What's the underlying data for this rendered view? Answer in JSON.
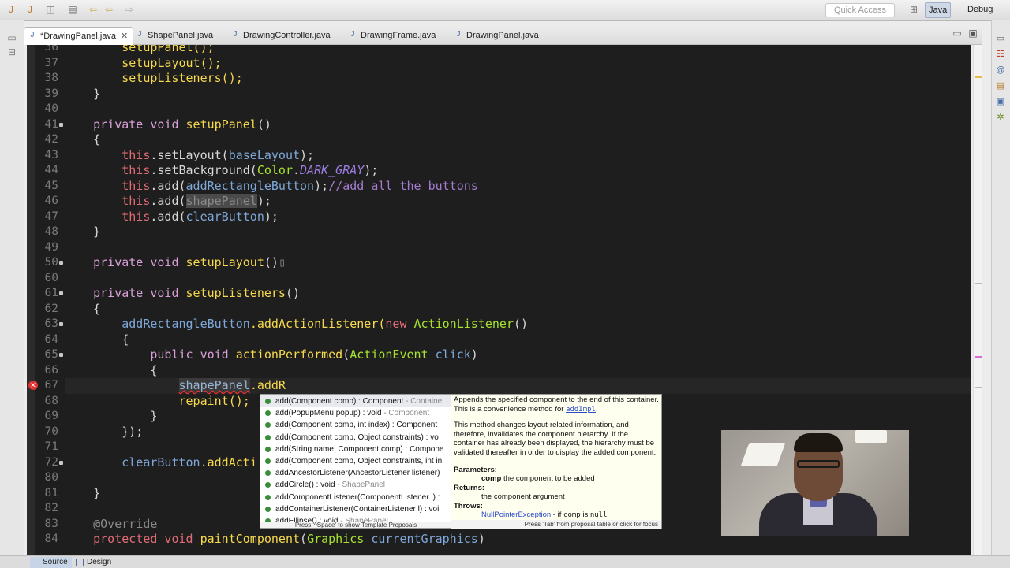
{
  "toolbar": {
    "quick_access_placeholder": "Quick Access",
    "perspectives": [
      {
        "label": "Java"
      },
      {
        "label": "Debug"
      }
    ],
    "icons": [
      "new-file-icon",
      "save-icon",
      "build-icon",
      "debug-icon",
      "run-icon",
      "back-icon",
      "forward-icon"
    ]
  },
  "tabs": [
    {
      "label": "*DrawingPanel.java",
      "close": "✕"
    },
    {
      "label": "ShapePanel.java"
    },
    {
      "label": "DrawingController.java"
    },
    {
      "label": "DrawingFrame.java"
    },
    {
      "label": "DrawingPanel.java"
    }
  ],
  "code": [
    {
      "n": "36",
      "text": "        setupPanel();"
    },
    {
      "n": "37",
      "text": "        setupLayout();"
    },
    {
      "n": "38",
      "text": "        setupListeners();"
    },
    {
      "n": "39",
      "text": "    }"
    },
    {
      "n": "40",
      "text": ""
    },
    {
      "n": "41",
      "kw": "    private void ",
      "m": "setupPanel",
      "rest": "()"
    },
    {
      "n": "42",
      "text": "    {"
    },
    {
      "n": "43",
      "this": "        this",
      "a": ".setLayout(",
      "f": "baseLayout",
      "b": ");"
    },
    {
      "n": "44",
      "this": "        this",
      "a": ".setBackground(",
      "t": "Color",
      "dot": ".",
      "c": "DARK_GRAY",
      "b": ");"
    },
    {
      "n": "45",
      "this": "        this",
      "a": ".add(",
      "f": "addRectangleButton",
      "b": ");",
      "cm": "//add all the buttons"
    },
    {
      "n": "46",
      "this": "        this",
      "a": ".add(",
      "hl": "shapePanel",
      "b": ");"
    },
    {
      "n": "47",
      "this": "        this",
      "a": ".add(",
      "f": "clearButton",
      "b": ");"
    },
    {
      "n": "48",
      "text": "    }"
    },
    {
      "n": "49",
      "text": ""
    },
    {
      "n": "50",
      "kw": "    private void ",
      "m": "setupLayout",
      "rest": "()",
      "box": "▯"
    },
    {
      "n": "60",
      "text": ""
    },
    {
      "n": "61",
      "kw": "    private void ",
      "m": "setupListeners",
      "rest": "()"
    },
    {
      "n": "62",
      "text": "    {"
    },
    {
      "n": "63",
      "f": "        addRectangleButton",
      "a": ".addActionListener(",
      "nw": "new ",
      "t": "ActionListener",
      "b": "()"
    },
    {
      "n": "64",
      "text": "        {"
    },
    {
      "n": "65",
      "kw": "            public void ",
      "m": "actionPerformed",
      "a": "(",
      "t": "ActionEvent",
      "sp": " ",
      "f": "click",
      "b": ")"
    },
    {
      "n": "66",
      "text": "            {"
    },
    {
      "n": "67",
      "err": "shapePanel",
      "a": ".addR"
    },
    {
      "n": "68",
      "text": "                repaint();"
    },
    {
      "n": "69",
      "text": "            }"
    },
    {
      "n": "70",
      "text": "        });"
    },
    {
      "n": "71",
      "text": ""
    },
    {
      "n": "72",
      "f": "        clearButton",
      "a": ".addActi"
    },
    {
      "n": "80",
      "text": ""
    },
    {
      "n": "81",
      "text": "    }"
    },
    {
      "n": "82",
      "text": ""
    },
    {
      "n": "83",
      "ann": "    @Override"
    },
    {
      "n": "84",
      "kw": "    protected void ",
      "m": "paintComponent",
      "a": "(",
      "t": "Graphics",
      "sp": " ",
      "f": "currentGraphics",
      "b": ")"
    }
  ],
  "completion": {
    "items": [
      {
        "text": "add(Component comp) : Component",
        "owner": " - Containe"
      },
      {
        "text": "add(PopupMenu popup) : void",
        "owner": " - Component"
      },
      {
        "text": "add(Component comp, int index) : Component",
        "owner": ""
      },
      {
        "text": "add(Component comp, Object constraints) : vo",
        "owner": ""
      },
      {
        "text": "add(String name, Component comp) : Compone",
        "owner": ""
      },
      {
        "text": "add(Component comp, Object constraints, int in",
        "owner": ""
      },
      {
        "text": "addAncestorListener(AncestorListener listener)",
        "owner": ""
      },
      {
        "text": "addCircle() : void",
        "owner": " - ShapePanel"
      },
      {
        "text": "addComponentListener(ComponentListener l) :",
        "owner": ""
      },
      {
        "text": "addContainerListener(ContainerListener l) : voi",
        "owner": ""
      },
      {
        "text": "addEllipse() : void",
        "owner": " - ShapePanel"
      }
    ],
    "footer": "Press '^Space' to show Template Proposals"
  },
  "doc": {
    "p1": "Appends the specified component to the end of this container. This is a convenience method for",
    "p1_link": "addImpl",
    "p2": "This method changes layout-related information, and therefore, invalidates the component hierarchy. If the container has already been displayed, the hierarchy must be validated thereafter in order to display the added component.",
    "params_label": "Parameters:",
    "param_name": "comp",
    "param_desc": " the component to be added",
    "returns_label": "Returns:",
    "returns_desc": "the component argument",
    "throws_label": "Throws:",
    "throws_link": "NullPointerException",
    "throws_desc": " - if ",
    "throws_code1": "comp",
    "throws_mid": " is ",
    "throws_code2": "null",
    "footer": "Press 'Tab' from proposal table or click for focus"
  },
  "bottom_tabs": [
    {
      "label": "Source"
    },
    {
      "label": "Design"
    }
  ]
}
